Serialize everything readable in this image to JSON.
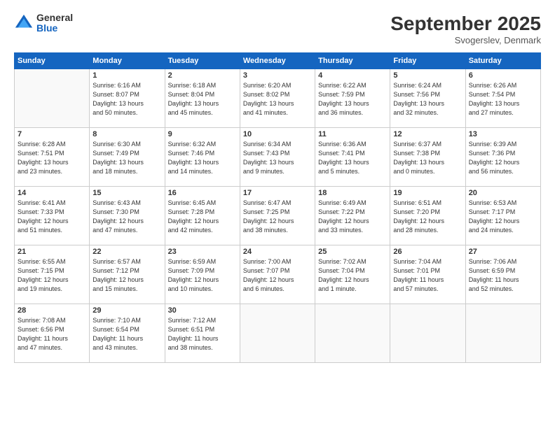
{
  "header": {
    "logo_general": "General",
    "logo_blue": "Blue",
    "month_title": "September 2025",
    "subtitle": "Svogerslev, Denmark"
  },
  "days_of_week": [
    "Sunday",
    "Monday",
    "Tuesday",
    "Wednesday",
    "Thursday",
    "Friday",
    "Saturday"
  ],
  "weeks": [
    [
      {
        "day": "",
        "info": ""
      },
      {
        "day": "1",
        "info": "Sunrise: 6:16 AM\nSunset: 8:07 PM\nDaylight: 13 hours\nand 50 minutes."
      },
      {
        "day": "2",
        "info": "Sunrise: 6:18 AM\nSunset: 8:04 PM\nDaylight: 13 hours\nand 45 minutes."
      },
      {
        "day": "3",
        "info": "Sunrise: 6:20 AM\nSunset: 8:02 PM\nDaylight: 13 hours\nand 41 minutes."
      },
      {
        "day": "4",
        "info": "Sunrise: 6:22 AM\nSunset: 7:59 PM\nDaylight: 13 hours\nand 36 minutes."
      },
      {
        "day": "5",
        "info": "Sunrise: 6:24 AM\nSunset: 7:56 PM\nDaylight: 13 hours\nand 32 minutes."
      },
      {
        "day": "6",
        "info": "Sunrise: 6:26 AM\nSunset: 7:54 PM\nDaylight: 13 hours\nand 27 minutes."
      }
    ],
    [
      {
        "day": "7",
        "info": "Sunrise: 6:28 AM\nSunset: 7:51 PM\nDaylight: 13 hours\nand 23 minutes."
      },
      {
        "day": "8",
        "info": "Sunrise: 6:30 AM\nSunset: 7:49 PM\nDaylight: 13 hours\nand 18 minutes."
      },
      {
        "day": "9",
        "info": "Sunrise: 6:32 AM\nSunset: 7:46 PM\nDaylight: 13 hours\nand 14 minutes."
      },
      {
        "day": "10",
        "info": "Sunrise: 6:34 AM\nSunset: 7:43 PM\nDaylight: 13 hours\nand 9 minutes."
      },
      {
        "day": "11",
        "info": "Sunrise: 6:36 AM\nSunset: 7:41 PM\nDaylight: 13 hours\nand 5 minutes."
      },
      {
        "day": "12",
        "info": "Sunrise: 6:37 AM\nSunset: 7:38 PM\nDaylight: 13 hours\nand 0 minutes."
      },
      {
        "day": "13",
        "info": "Sunrise: 6:39 AM\nSunset: 7:36 PM\nDaylight: 12 hours\nand 56 minutes."
      }
    ],
    [
      {
        "day": "14",
        "info": "Sunrise: 6:41 AM\nSunset: 7:33 PM\nDaylight: 12 hours\nand 51 minutes."
      },
      {
        "day": "15",
        "info": "Sunrise: 6:43 AM\nSunset: 7:30 PM\nDaylight: 12 hours\nand 47 minutes."
      },
      {
        "day": "16",
        "info": "Sunrise: 6:45 AM\nSunset: 7:28 PM\nDaylight: 12 hours\nand 42 minutes."
      },
      {
        "day": "17",
        "info": "Sunrise: 6:47 AM\nSunset: 7:25 PM\nDaylight: 12 hours\nand 38 minutes."
      },
      {
        "day": "18",
        "info": "Sunrise: 6:49 AM\nSunset: 7:22 PM\nDaylight: 12 hours\nand 33 minutes."
      },
      {
        "day": "19",
        "info": "Sunrise: 6:51 AM\nSunset: 7:20 PM\nDaylight: 12 hours\nand 28 minutes."
      },
      {
        "day": "20",
        "info": "Sunrise: 6:53 AM\nSunset: 7:17 PM\nDaylight: 12 hours\nand 24 minutes."
      }
    ],
    [
      {
        "day": "21",
        "info": "Sunrise: 6:55 AM\nSunset: 7:15 PM\nDaylight: 12 hours\nand 19 minutes."
      },
      {
        "day": "22",
        "info": "Sunrise: 6:57 AM\nSunset: 7:12 PM\nDaylight: 12 hours\nand 15 minutes."
      },
      {
        "day": "23",
        "info": "Sunrise: 6:59 AM\nSunset: 7:09 PM\nDaylight: 12 hours\nand 10 minutes."
      },
      {
        "day": "24",
        "info": "Sunrise: 7:00 AM\nSunset: 7:07 PM\nDaylight: 12 hours\nand 6 minutes."
      },
      {
        "day": "25",
        "info": "Sunrise: 7:02 AM\nSunset: 7:04 PM\nDaylight: 12 hours\nand 1 minute."
      },
      {
        "day": "26",
        "info": "Sunrise: 7:04 AM\nSunset: 7:01 PM\nDaylight: 11 hours\nand 57 minutes."
      },
      {
        "day": "27",
        "info": "Sunrise: 7:06 AM\nSunset: 6:59 PM\nDaylight: 11 hours\nand 52 minutes."
      }
    ],
    [
      {
        "day": "28",
        "info": "Sunrise: 7:08 AM\nSunset: 6:56 PM\nDaylight: 11 hours\nand 47 minutes."
      },
      {
        "day": "29",
        "info": "Sunrise: 7:10 AM\nSunset: 6:54 PM\nDaylight: 11 hours\nand 43 minutes."
      },
      {
        "day": "30",
        "info": "Sunrise: 7:12 AM\nSunset: 6:51 PM\nDaylight: 11 hours\nand 38 minutes."
      },
      {
        "day": "",
        "info": ""
      },
      {
        "day": "",
        "info": ""
      },
      {
        "day": "",
        "info": ""
      },
      {
        "day": "",
        "info": ""
      }
    ]
  ]
}
